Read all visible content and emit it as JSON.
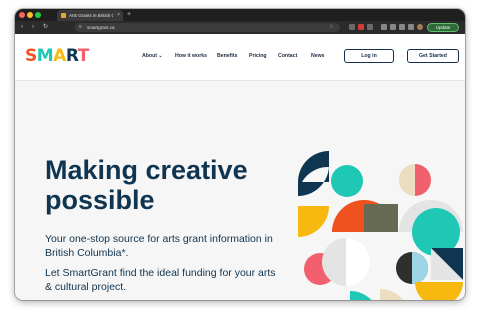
{
  "browser": {
    "tab_title": "Arts Grants in British Columbia",
    "tab_close": "×",
    "new_tab": "+",
    "nav_back": "‹",
    "nav_forward": "›",
    "nav_reload": "↻",
    "url": "smartgrant.ca",
    "update_label": "Update"
  },
  "site": {
    "logo_text": "SMART",
    "nav": [
      {
        "label": "About ⌄"
      },
      {
        "label": "How it works"
      },
      {
        "label": "Benefits"
      },
      {
        "label": "Pricing"
      },
      {
        "label": "Contact"
      },
      {
        "label": "News"
      }
    ],
    "login_label": "Log in",
    "get_started_label": "Get Started"
  },
  "hero": {
    "title": "Making creative possible",
    "subtitle_1": "Your one-stop source for arts grant information in British Columbia*.",
    "subtitle_2": "Let SmartGrant find the ideal funding for your arts & cultural project."
  },
  "colors": {
    "navy": "#0f3551",
    "teal": "#1ec8b4",
    "yellow": "#f7b90f",
    "orange": "#f0521f",
    "pink": "#f1606c",
    "olive": "#676a53",
    "beige": "#ecdcc0",
    "lightgray": "#e4e4e4",
    "lightblue": "#9ed5e6",
    "dark": "#2e2e2e"
  },
  "icons": {
    "back": "chevron-left-icon",
    "forward": "chevron-right-icon",
    "reload": "reload-icon",
    "site_info": "tune-icon",
    "bookmark": "star-icon"
  }
}
